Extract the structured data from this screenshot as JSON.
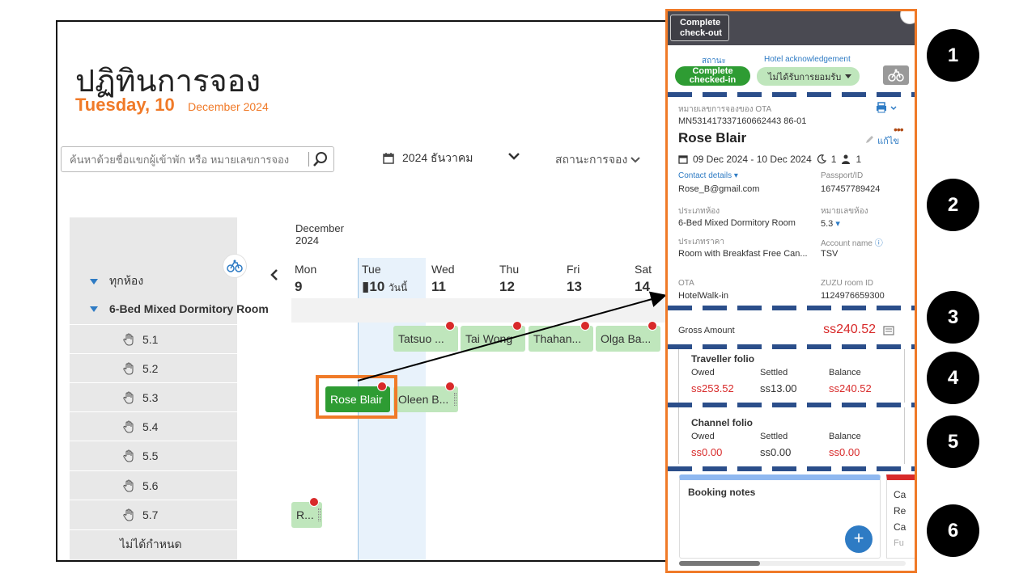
{
  "page": {
    "title": "ปฏิทินการจอง",
    "current_day": "Tuesday, 10",
    "current_month": "December 2024"
  },
  "toolbar": {
    "search_placeholder": "ค้นหาด้วยชื่อแขกผู้เข้าพัก หรือ หมายเลขการจอง",
    "month_picker": "2024 ธันวาคม",
    "status_filter": "สถานะการจอง"
  },
  "calendar": {
    "month_label": "December 2024",
    "days": [
      {
        "name": "Mon",
        "num": "9"
      },
      {
        "name": "Tue",
        "num": "10",
        "tag": "วันนี้"
      },
      {
        "name": "Wed",
        "num": "11"
      },
      {
        "name": "Thu",
        "num": "12"
      },
      {
        "name": "Fri",
        "num": "13"
      },
      {
        "name": "Sat",
        "num": "14"
      }
    ],
    "all_rooms": "ทุกห้อง",
    "room_type": "6-Bed Mixed Dormitory Room",
    "rooms": [
      "5.1",
      "5.2",
      "5.3",
      "5.4",
      "5.5",
      "5.6",
      "5.7"
    ],
    "unassigned": "ไม่ได้กำหนด",
    "bookings": [
      {
        "label": "Tatsuo ..."
      },
      {
        "label": "Tai Wong"
      },
      {
        "label": "Thahan..."
      },
      {
        "label": "Olga Ba..."
      },
      {
        "label": "Rose Blair"
      },
      {
        "label": "Oleen B..."
      },
      {
        "label": "R..."
      }
    ]
  },
  "panel": {
    "checkout_label": "Complete check-out",
    "status_label": "สถานะ",
    "status_value": "Complete checked-in",
    "ack_label": "Hotel acknowledgement",
    "ack_value": "ไม่ได้รับการยอมรับ",
    "ota_number_label": "หมายเลขการจองของ OTA",
    "ota_number": "MN531417337160662443 86-01",
    "guest_name": "Rose Blair",
    "edit_label": "แก้ไข",
    "dates": "09 Dec 2024 - 10 Dec 2024",
    "nights": "1",
    "guests": "1",
    "contact_label": "Contact details",
    "contact_value": "Rose_B@gmail.com",
    "passport_label": "Passport/ID",
    "passport_value": "167457789424",
    "room_type_label": "ประเภทห้อง",
    "room_type_value": "6-Bed Mixed Dormitory Room",
    "room_no_label": "หมายเลขห้อง",
    "room_no_value": "5.3",
    "rate_label": "ประเภทราคา",
    "rate_value": "Room with Breakfast Free Can...",
    "account_label": "Account name",
    "account_value": "TSV",
    "ota_label": "OTA",
    "ota_value": "HotelWalk-in",
    "zuzu_label": "ZUZU room ID",
    "zuzu_value": "1124976659300",
    "gross_label": "Gross Amount",
    "gross_value": "ss240.52",
    "traveller_folio": {
      "title": "Traveller folio",
      "owed_label": "Owed",
      "settled_label": "Settled",
      "balance_label": "Balance",
      "owed": "ss253.52",
      "settled": "ss13.00",
      "balance": "ss240.52"
    },
    "channel_folio": {
      "title": "Channel folio",
      "owed_label": "Owed",
      "settled_label": "Settled",
      "balance_label": "Balance",
      "owed": "ss0.00",
      "settled": "ss0.00",
      "balance": "ss0.00"
    },
    "notes_title": "Booking notes",
    "plus_label": "+",
    "card2_lines": [
      "Ca",
      "Re",
      "Ca",
      "Fu"
    ]
  },
  "steps": [
    "1",
    "2",
    "3",
    "4",
    "5",
    "6"
  ],
  "colors": {
    "accent_orange": "#f07a28",
    "green_selected": "#2e9c33",
    "green_light": "#bfe6bc",
    "red": "#d82a2a",
    "blue": "#2e7bc4",
    "dash_blue": "#2b4e8a"
  }
}
